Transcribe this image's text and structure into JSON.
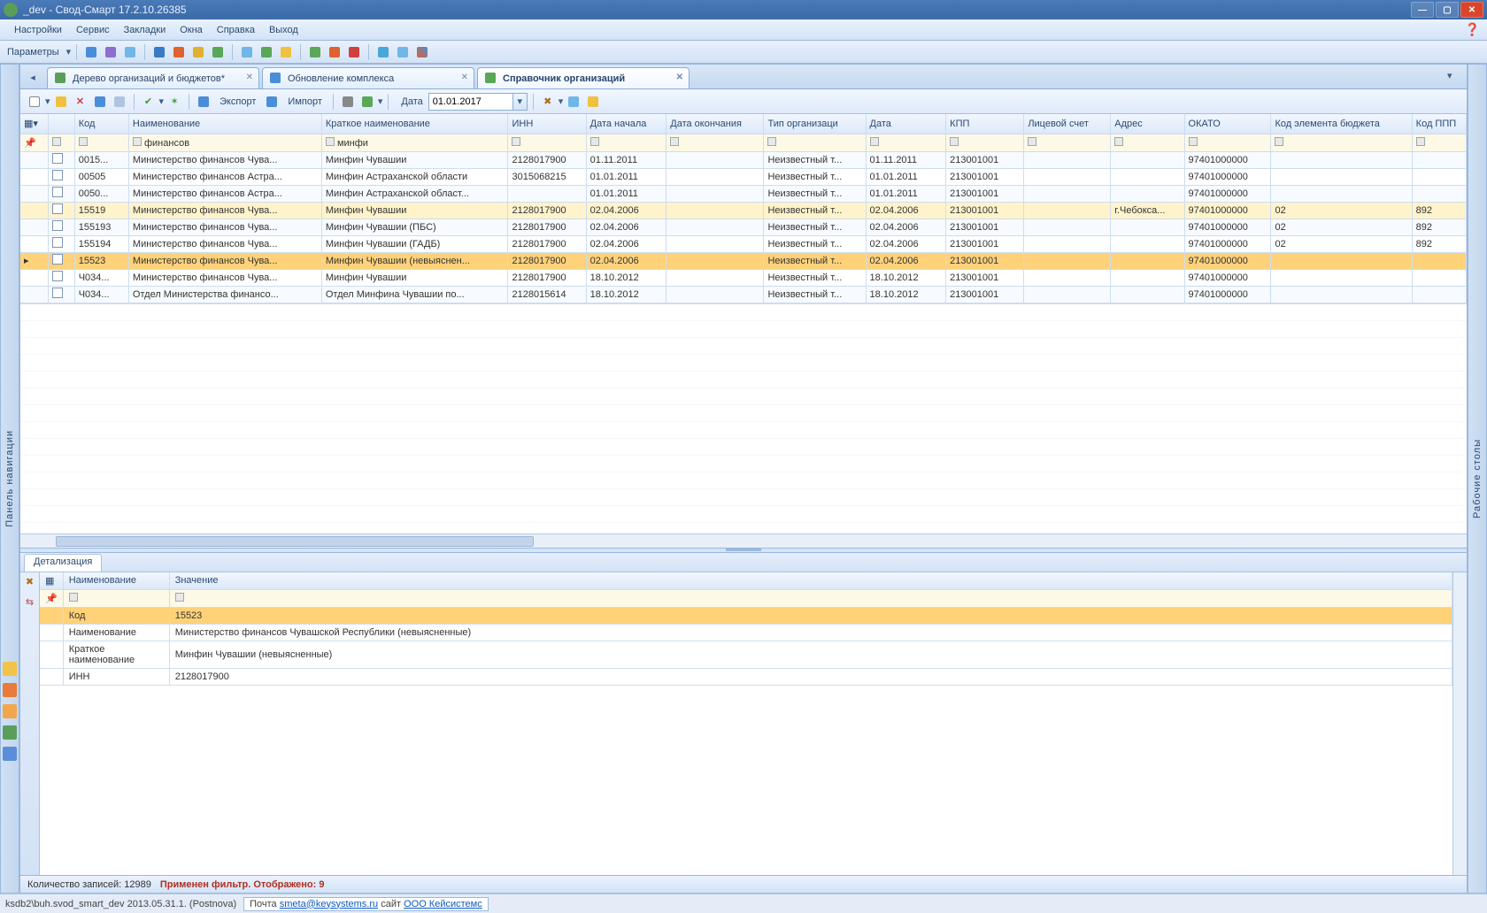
{
  "window": {
    "title": "_dev - Свод-Смарт 17.2.10.26385"
  },
  "menu": {
    "items": [
      "Настройки",
      "Сервис",
      "Закладки",
      "Окна",
      "Справка",
      "Выход"
    ]
  },
  "toolbar1": {
    "label": "Параметры"
  },
  "tabs": [
    {
      "label": "Дерево организаций и бюджетов*",
      "active": false
    },
    {
      "label": "Обновление комплекса",
      "active": false
    },
    {
      "label": "Справочник организаций",
      "active": true
    }
  ],
  "toolbar2": {
    "export": "Экспорт",
    "import": "Импорт",
    "date_label": "Дата",
    "date_value": "01.01.2017"
  },
  "sidebars": {
    "left": "Панель навигации",
    "right": "Рабочие столы"
  },
  "grid": {
    "columns": [
      "",
      "",
      "Код",
      "Наименование",
      "Краткое наименование",
      "ИНН",
      "Дата начала",
      "Дата окончания",
      "Тип организаци",
      "Дата",
      "КПП",
      "Лицевой счет",
      "Адрес",
      "ОКАТО",
      "Код элемента бюджета",
      "Код ППП"
    ],
    "filter": [
      "",
      "",
      "",
      "финансов",
      "минфи",
      "",
      "",
      "",
      "",
      "",
      "",
      "",
      "",
      "",
      "",
      ""
    ],
    "rows": [
      {
        "code": "0015...",
        "name": "Министерство финансов Чува...",
        "short": "Минфин Чувашии",
        "inn": "2128017900",
        "start": "01.11.2011",
        "end": "",
        "type": "Неизвестный т...",
        "date": "01.11.2011",
        "kpp": "213001001",
        "acct": "",
        "addr": "",
        "okato": "97401000000",
        "budget": "",
        "ppp": ""
      },
      {
        "code": "00505",
        "name": "Министерство финансов Астра...",
        "short": "Минфин Астраханской области",
        "inn": "3015068215",
        "start": "01.01.2011",
        "end": "",
        "type": "Неизвестный т...",
        "date": "01.01.2011",
        "kpp": "213001001",
        "acct": "",
        "addr": "",
        "okato": "97401000000",
        "budget": "",
        "ppp": ""
      },
      {
        "code": "0050...",
        "name": "Министерство финансов Астра...",
        "short": "Минфин Астраханской област...",
        "inn": "",
        "start": "01.01.2011",
        "end": "",
        "type": "Неизвестный т...",
        "date": "01.01.2011",
        "kpp": "213001001",
        "acct": "",
        "addr": "",
        "okato": "97401000000",
        "budget": "",
        "ppp": ""
      },
      {
        "code": "15519",
        "name": "Министерство финансов Чува...",
        "short": "Минфин Чувашии",
        "inn": "2128017900",
        "start": "02.04.2006",
        "end": "",
        "type": "Неизвестный т...",
        "date": "02.04.2006",
        "kpp": "213001001",
        "acct": "",
        "addr": "г.Чебокса...",
        "okato": "97401000000",
        "budget": "02",
        "ppp": "892",
        "hl": true
      },
      {
        "code": "155193",
        "name": "Министерство финансов Чува...",
        "short": "Минфин Чувашии (ПБС)",
        "inn": "2128017900",
        "start": "02.04.2006",
        "end": "",
        "type": "Неизвестный т...",
        "date": "02.04.2006",
        "kpp": "213001001",
        "acct": "",
        "addr": "",
        "okato": "97401000000",
        "budget": "02",
        "ppp": "892"
      },
      {
        "code": "155194",
        "name": "Министерство финансов Чува...",
        "short": "Минфин Чувашии (ГАДБ)",
        "inn": "2128017900",
        "start": "02.04.2006",
        "end": "",
        "type": "Неизвестный т...",
        "date": "02.04.2006",
        "kpp": "213001001",
        "acct": "",
        "addr": "",
        "okato": "97401000000",
        "budget": "02",
        "ppp": "892"
      },
      {
        "code": "15523",
        "name": "Министерство финансов Чува...",
        "short": "Минфин Чувашии (невыяснен...",
        "inn": "2128017900",
        "start": "02.04.2006",
        "end": "",
        "type": "Неизвестный т...",
        "date": "02.04.2006",
        "kpp": "213001001",
        "acct": "",
        "addr": "",
        "okato": "97401000000",
        "budget": "",
        "ppp": "",
        "sel": true
      },
      {
        "code": "Ч034...",
        "name": "Министерство финансов Чува...",
        "short": "Минфин Чувашии",
        "inn": "2128017900",
        "start": "18.10.2012",
        "end": "",
        "type": "Неизвестный т...",
        "date": "18.10.2012",
        "kpp": "213001001",
        "acct": "",
        "addr": "",
        "okato": "97401000000",
        "budget": "",
        "ppp": ""
      },
      {
        "code": "Ч034...",
        "name": "Отдел Министерства финансо...",
        "short": "Отдел Минфина Чувашии по...",
        "inn": "2128015614",
        "start": "18.10.2012",
        "end": "",
        "type": "Неизвестный т...",
        "date": "18.10.2012",
        "kpp": "213001001",
        "acct": "",
        "addr": "",
        "okato": "97401000000",
        "budget": "",
        "ppp": ""
      }
    ]
  },
  "detail": {
    "tab": "Детализация",
    "headers": [
      "Наименование",
      "Значение"
    ],
    "rows": [
      {
        "k": "Код",
        "v": "15523",
        "sel": true
      },
      {
        "k": "Наименование",
        "v": "Министерство финансов Чувашской Республики (невыясненные)"
      },
      {
        "k": "Краткое наименование",
        "v": "Минфин Чувашии (невыясненные)"
      },
      {
        "k": "ИНН",
        "v": "2128017900"
      }
    ]
  },
  "status": {
    "count_label": "Количество записей: ",
    "count": "12989",
    "filter": "Применен фильтр. Отображено: 9"
  },
  "footer": {
    "conn": "ksdb2\\buh.svod_smart_dev 2013.05.31.1. (Postnova)",
    "mail_pre": "Почта ",
    "mail": "smeta@keysystems.ru",
    "site_pre": " сайт ",
    "site": "ООО Кейсистемс"
  }
}
